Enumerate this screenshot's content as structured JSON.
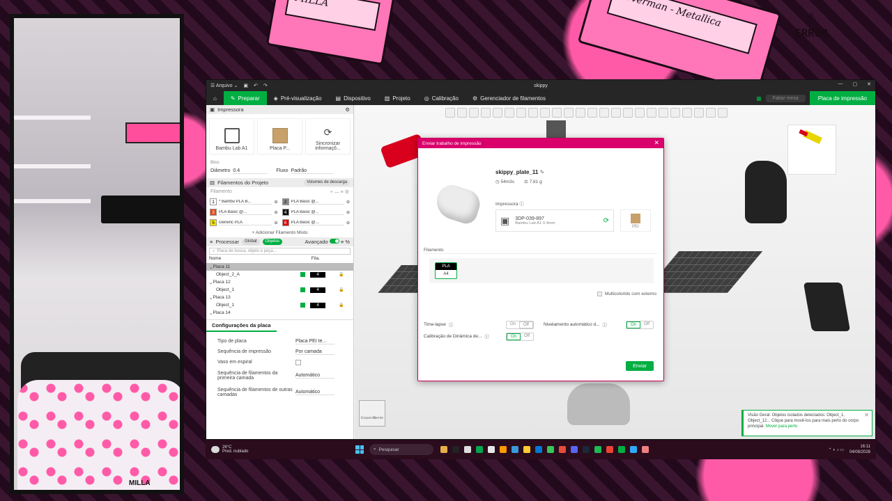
{
  "background": {
    "error_text": "ERROR",
    "cassette_1": "Loverman - Metallica",
    "cassette_2": "MILLA",
    "webcam_tag": "MILLA"
  },
  "window": {
    "menu_label": "Arquivo",
    "title": "skippy"
  },
  "nav": {
    "tabs": [
      "Preparar",
      "Pré-visualização",
      "Dispositivo",
      "Projeto",
      "Calibração",
      "Gerenciador de filamentos"
    ],
    "slice_label": "Fatiar mesa",
    "print_label": "Placa de impressão"
  },
  "left": {
    "printer_section": "Impressora",
    "printer_name": "Bambu Lab A1",
    "plate_name": "Placa P...",
    "sync_label": "Sincronizar informaçõ...",
    "nozzle_label": "Bico",
    "diameter_label": "Diâmetro",
    "diameter_value": "0.4",
    "flow_label": "Fluxo",
    "flow_value": "Padrão",
    "filament_section": "Filamentos do Projeto",
    "filament_badge": "Volumes de descarga",
    "filament_label": "Filamento",
    "filaments": [
      {
        "num": "1",
        "name": "* Bambu PLA B...",
        "color": "#ffffff"
      },
      {
        "num": "2",
        "name": "PLA Basic @...",
        "color": "#8a8a8a"
      },
      {
        "num": "3",
        "name": "PLA Basic @...",
        "color": "#e04a1a"
      },
      {
        "num": "4",
        "name": "PLA Basic @...",
        "color": "#111111"
      },
      {
        "num": "5",
        "name": "Generic PLA",
        "color": "#f5e400"
      },
      {
        "num": "6",
        "name": "PLA Basic @...",
        "color": "#e00000"
      }
    ],
    "add_mixed": "+ Adicionar Filamento Misto",
    "process_section": "Processar",
    "process_global": "Global",
    "process_objects": "Objetos",
    "process_advanced": "Avançado",
    "search_placeholder": "Placa de busca, objeto e peça...",
    "col_name": "Nome",
    "col_fila": "Fila.",
    "objects": [
      {
        "label": "Placa 11",
        "indent": 0,
        "sel": true,
        "fil": ""
      },
      {
        "label": "Object_2_A",
        "indent": 1,
        "sel": false,
        "fil": "4"
      },
      {
        "label": "Placa 12",
        "indent": 0,
        "sel": false,
        "fil": ""
      },
      {
        "label": "Object_1",
        "indent": 1,
        "sel": false,
        "fil": "4"
      },
      {
        "label": "Placa 13",
        "indent": 0,
        "sel": false,
        "fil": ""
      },
      {
        "label": "Object_1",
        "indent": 1,
        "sel": false,
        "fil": "4"
      },
      {
        "label": "Placa 14",
        "indent": 0,
        "sel": false,
        "fil": ""
      }
    ],
    "plate_settings_tab": "Configurações da placa",
    "props": [
      {
        "k": "Tipo de placa",
        "v": "Placa PEI te..."
      },
      {
        "k": "Sequência de impressão",
        "v": "Por camada"
      },
      {
        "k": "Vaso em espiral",
        "v": ""
      },
      {
        "k": "Sequência de filamentos da primeira camada",
        "v": "Automático"
      },
      {
        "k": "Sequência de filamentos de outras camadas",
        "v": "Automático"
      }
    ]
  },
  "viewport": {
    "cube_front": "Frente",
    "cube_left": "Esquerda"
  },
  "dialog": {
    "title": "Enviar trabalho de impressão",
    "job_name": "skippy_plate_11",
    "time": "54m3s",
    "weight": "7.81 g",
    "printer_label": "Impressora",
    "printer_id": "3DP-039-897",
    "printer_model": "Bambu Lab A1  0.4mm",
    "plate_type": "PEI",
    "filament_label": "Filamento",
    "chip_type": "PLA",
    "chip_slot": "A4",
    "multicolor_label": "Multicolorido com externo",
    "timelapse_label": "Time-lapse",
    "leveling_label": "Nivelamento automático d...",
    "calib_label": "Calibração de Dinâmica de...",
    "on": "On",
    "off": "Off",
    "send_label": "Enviar"
  },
  "notification": {
    "text": "Visão Geral: Objetos isolados detectados: Object_1, Object_12... Clique para movê-los para mais perto do corpo principal.",
    "link": "Mover para perto"
  },
  "taskbar": {
    "temp": "26°C",
    "weather": "Pred. nublado",
    "search": "Pesquisar",
    "time": "16:11",
    "date": "04/08/2026"
  }
}
